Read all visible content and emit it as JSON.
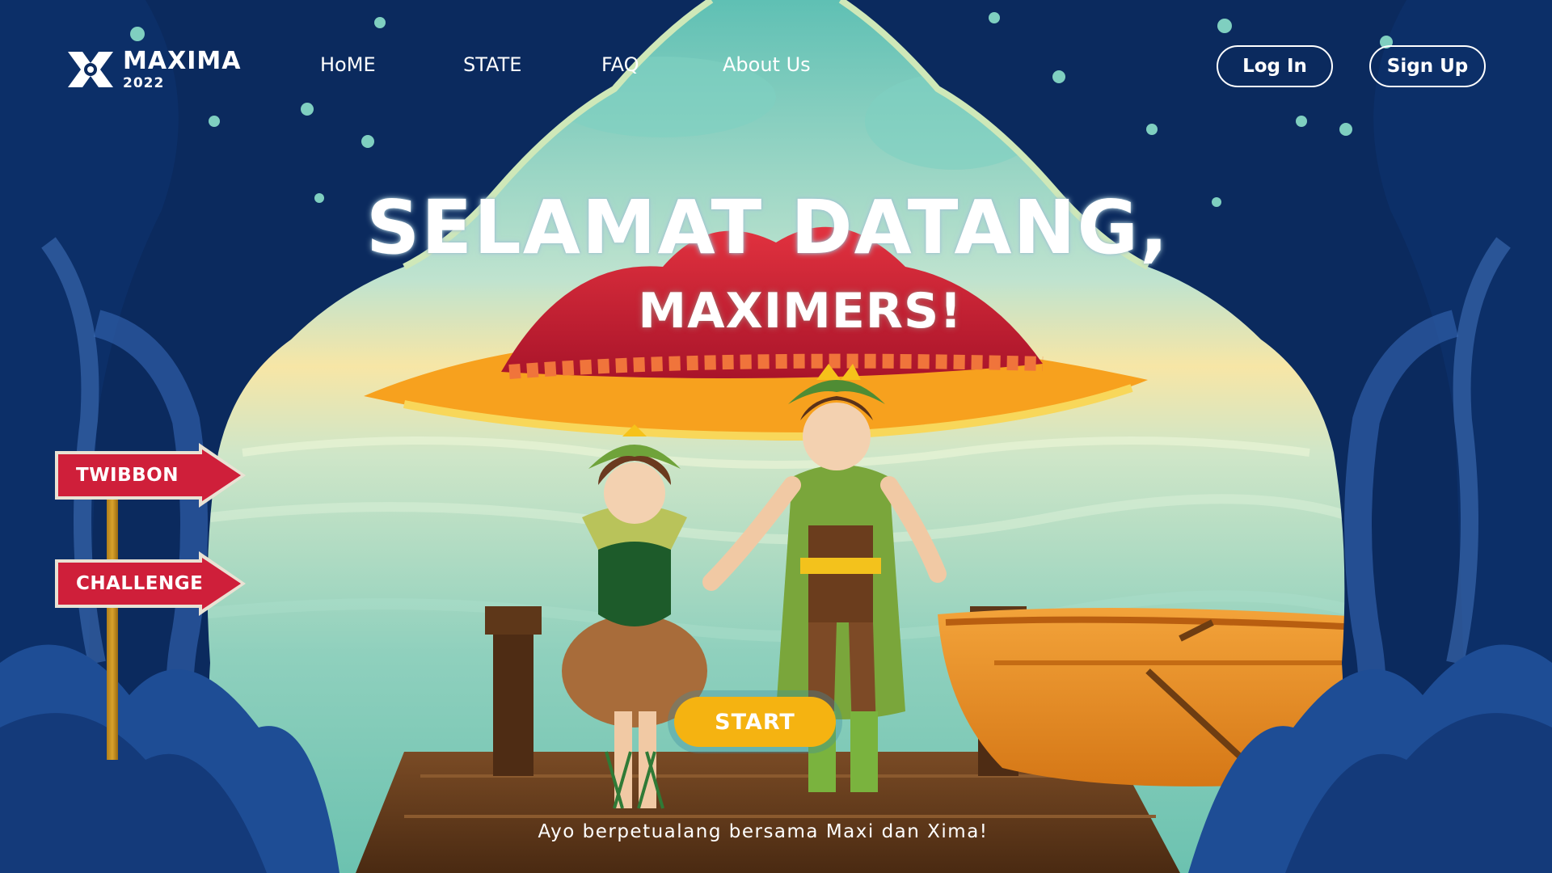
{
  "brand": {
    "name": "MAXIMA",
    "year": "2022"
  },
  "nav": {
    "items": [
      {
        "label": "HoME"
      },
      {
        "label": "STATE"
      },
      {
        "label": "FAQ"
      },
      {
        "label": "About Us"
      }
    ]
  },
  "auth": {
    "login_label": "Log In",
    "signup_label": "Sign Up"
  },
  "hero": {
    "title": "SELAMAT DATANG,",
    "subtitle": "MAXIMERS!",
    "start_label": "START",
    "tagline": "Ayo berpetualang bersama Maxi dan Xima!"
  },
  "signs": {
    "twibbon_label": "TWIBBON",
    "challenge_label": "CHALLENGE"
  },
  "colors": {
    "night_blue": "#0a2a5c",
    "sign_red": "#cf1f3a",
    "start_yellow": "#f5b311",
    "sea_teal": "#6cc2b0",
    "island_red": "#c8202e"
  }
}
